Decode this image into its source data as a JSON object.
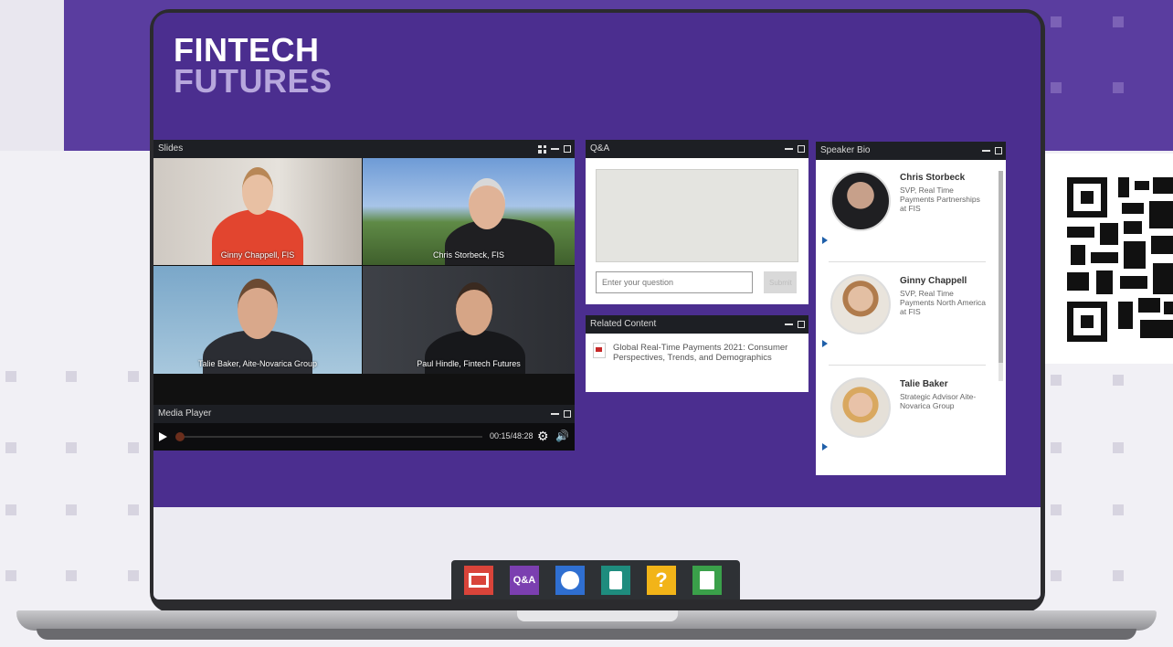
{
  "logo": {
    "line1": "FINTECH",
    "line2": "FUTURES"
  },
  "panels": {
    "slides": {
      "title": "Slides"
    },
    "media_player": {
      "title": "Media Player",
      "time": "00:15/48:28"
    },
    "qa": {
      "title": "Q&A",
      "input_placeholder": "Enter your question",
      "submit_label": "Submit"
    },
    "related": {
      "title": "Related Content",
      "item": "Global Real-Time Payments 2021: Consumer Perspectives, Trends, and Demographics"
    },
    "speaker_bio": {
      "title": "Speaker Bio"
    }
  },
  "participants": [
    {
      "name": "Ginny Chappell, FIS"
    },
    {
      "name": "Chris Storbeck, FIS"
    },
    {
      "name": "Talie Baker, Aite-Novarica Group"
    },
    {
      "name": "Paul Hindle, Fintech Futures"
    }
  ],
  "speakers": [
    {
      "name": "Chris Storbeck",
      "title": "SVP, Real Time Payments Partnerships at FIS"
    },
    {
      "name": "Ginny Chappell",
      "title": "SVP, Real Time Payments North America at FIS"
    },
    {
      "name": "Talie Baker",
      "title": "Strategic Advisor Aite-Novarica Group"
    }
  ],
  "dock": [
    {
      "icon": "media-player-icon",
      "label": "",
      "color": "#d9443a"
    },
    {
      "icon": "qa-icon",
      "label": "Q&A",
      "color": "#7b3fb0"
    },
    {
      "icon": "speaker-icon",
      "label": "",
      "color": "#2f6fd1"
    },
    {
      "icon": "clipboard-icon",
      "label": "",
      "color": "#1e8c7e"
    },
    {
      "icon": "help-icon",
      "label": "?",
      "color": "#f2b418"
    },
    {
      "icon": "document-icon",
      "label": "",
      "color": "#3aa04a"
    }
  ],
  "colors": {
    "brand_purple": "#4b2e8f",
    "panel_header": "#1d1f24"
  }
}
